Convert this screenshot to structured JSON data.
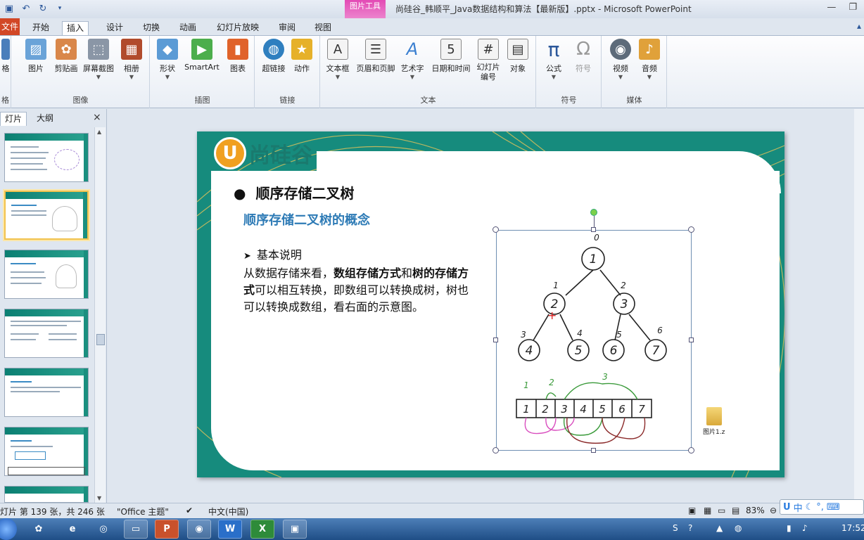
{
  "window": {
    "title": "尚硅谷_韩顺平_Java数据结构和算法【最新版】.pptx - Microsoft PowerPoint",
    "contextual_tab_group": "图片工具",
    "contextual_tab": "格式",
    "controls": [
      "—",
      "❐"
    ]
  },
  "tabs": [
    {
      "label": "文件"
    },
    {
      "label": "开始"
    },
    {
      "label": "插入"
    },
    {
      "label": "设计"
    },
    {
      "label": "切换"
    },
    {
      "label": "动画"
    },
    {
      "label": "幻灯片放映"
    },
    {
      "label": "审阅"
    },
    {
      "label": "视图"
    }
  ],
  "ribbon": {
    "groups": [
      {
        "label": "格",
        "buttons": [
          {
            "label": "格",
            "icon": "table-icon"
          }
        ]
      },
      {
        "label": "图像",
        "buttons": [
          {
            "label": "图片",
            "icon": "picture-icon"
          },
          {
            "label": "剪贴画",
            "icon": "clipart-icon"
          },
          {
            "label": "屏幕截图",
            "icon": "screenshot-icon"
          },
          {
            "label": "相册",
            "icon": "album-icon"
          }
        ]
      },
      {
        "label": "插图",
        "buttons": [
          {
            "label": "形状",
            "icon": "shapes-icon"
          },
          {
            "label": "SmartArt",
            "icon": "smartart-icon"
          },
          {
            "label": "图表",
            "icon": "chart-icon"
          }
        ]
      },
      {
        "label": "链接",
        "buttons": [
          {
            "label": "超链接",
            "icon": "hyperlink-icon"
          },
          {
            "label": "动作",
            "icon": "action-icon"
          }
        ]
      },
      {
        "label": "文本",
        "buttons": [
          {
            "label": "文本框",
            "icon": "textbox-icon"
          },
          {
            "label": "页眉和页脚",
            "icon": "header-footer-icon"
          },
          {
            "label": "艺术字",
            "icon": "wordart-icon"
          },
          {
            "label": "日期和时间",
            "icon": "datetime-icon"
          },
          {
            "label": "幻灯片\n编号",
            "icon": "slide-number-icon"
          },
          {
            "label": "对象",
            "icon": "object-icon"
          }
        ]
      },
      {
        "label": "符号",
        "buttons": [
          {
            "label": "公式",
            "icon": "equation-icon"
          },
          {
            "label": "符号",
            "icon": "symbol-icon"
          }
        ]
      },
      {
        "label": "媒体",
        "buttons": [
          {
            "label": "视频",
            "icon": "video-icon"
          },
          {
            "label": "音频",
            "icon": "audio-icon"
          }
        ]
      }
    ]
  },
  "panel": {
    "tabs": [
      "灯片",
      "大纲"
    ],
    "close": "×",
    "thumbnail_count": 7,
    "selected_index": 1
  },
  "slide": {
    "logo_letter": "U",
    "logo_text": "尚硅谷",
    "heading": "顺序存储二叉树",
    "subheading": "顺序存储二叉树的概念",
    "bullet_label": "基本说明",
    "body_parts": [
      {
        "text": "从数据存储来看，",
        "bold": false
      },
      {
        "text": "数组存储方式",
        "bold": true
      },
      {
        "text": "和",
        "bold": false
      },
      {
        "text": "树的存储方式",
        "bold": true
      },
      {
        "text": "可以相互转换，即数组可以转换成树，树也可以转换成数组，看右面的示意图。",
        "bold": false
      }
    ],
    "picture": {
      "tree_nodes": [
        "1",
        "2",
        "3",
        "4",
        "5",
        "6",
        "7"
      ],
      "node_indices": [
        "0",
        "1",
        "2",
        "3",
        "4",
        "5",
        "6"
      ],
      "array_cells": [
        "1",
        "2",
        "3",
        "4",
        "5",
        "6",
        "7"
      ],
      "array_labels": [
        "1",
        "2",
        "3"
      ]
    }
  },
  "desktop_file": "图片1.z",
  "status": {
    "slide_position": "灯片 第 139 张，共 246 张",
    "theme": "\"Office 主题\"",
    "language": "中文(中国)",
    "zoom": "83%"
  },
  "ime": {
    "text": "中"
  },
  "taskbar": {
    "apps": [
      "P",
      "W",
      "X"
    ],
    "time": "17:52"
  }
}
